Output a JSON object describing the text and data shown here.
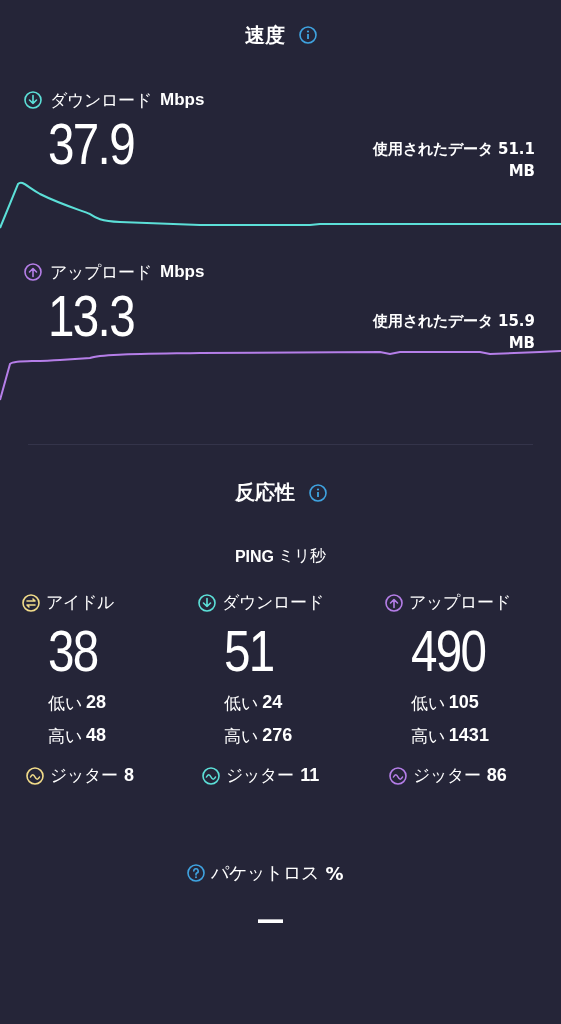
{
  "speed": {
    "title": "速度",
    "tests": [
      {
        "kind": "download",
        "label": "ダウンロード",
        "unit": "Mbps",
        "value": "37.9",
        "data_used": "使用されたデータ 51.1 MB",
        "color": "#5ce0d8"
      },
      {
        "kind": "upload",
        "label": "アップロード",
        "unit": "Mbps",
        "value": "13.3",
        "data_used": "使用されたデータ 15.9 MB",
        "color": "#b57ee8"
      }
    ]
  },
  "responsiveness": {
    "title": "反応性",
    "ping_label": "PING",
    "ping_unit": "ミリ秒",
    "columns": [
      {
        "kind": "idle",
        "label": "アイドル",
        "value": "38",
        "low_label": "低い",
        "low": "28",
        "high_label": "高い",
        "high": "48",
        "jitter_label": "ジッター",
        "jitter": "8",
        "color": "#f2dc8a"
      },
      {
        "kind": "download",
        "label": "ダウンロード",
        "value": "51",
        "low_label": "低い",
        "low": "24",
        "high_label": "高い",
        "high": "276",
        "jitter_label": "ジッター",
        "jitter": "11",
        "color": "#5ce0d8"
      },
      {
        "kind": "upload",
        "label": "アップロード",
        "value": "490",
        "low_label": "低い",
        "low": "105",
        "high_label": "高い",
        "high": "1431",
        "jitter_label": "ジッター",
        "jitter": "86",
        "color": "#b57ee8"
      }
    ]
  },
  "packet_loss": {
    "label": "パケットロス",
    "unit": "%",
    "value": "—"
  }
}
